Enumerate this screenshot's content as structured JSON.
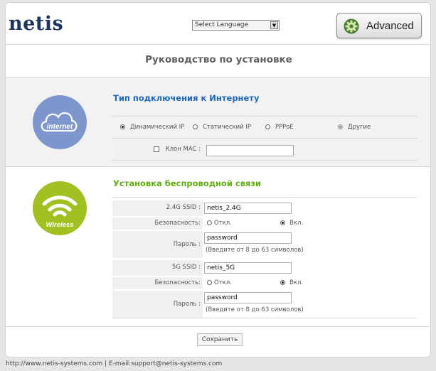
{
  "header": {
    "logo": "netis",
    "language_select": "Select Language",
    "advanced_label": "Advanced"
  },
  "page_title": "Руководство по установке",
  "internet": {
    "title": "Тип подключения к Интернету",
    "icon_text": "internet",
    "connection_types": [
      {
        "label": "Динамический IP",
        "selected": true
      },
      {
        "label": "Статический IP",
        "selected": false
      },
      {
        "label": "PPPoE",
        "selected": false
      },
      {
        "label": "Другие",
        "selected": false
      }
    ],
    "clone_mac_label": "Клон MAC :",
    "clone_mac_value": ""
  },
  "wireless": {
    "title": "Установка беспроводной связи",
    "icon_text": "Wireless",
    "band_24": {
      "ssid_label": "2.4G SSID :",
      "ssid_value": "netis_2.4G",
      "security_label": "Безопасность:",
      "off_label": "Откл.",
      "on_label": "Вкл.",
      "security_on": true,
      "password_label": "Пароль :",
      "password_value": "password",
      "password_hint": "(Введите от 8 до 63 символов)"
    },
    "band_5": {
      "ssid_label": "5G SSID :",
      "ssid_value": "netis_5G",
      "security_label": "Безопасность:",
      "off_label": "Откл.",
      "on_label": "Вкл.",
      "security_on": true,
      "password_label": "Пароль :",
      "password_value": "password",
      "password_hint": "(Введите от 8 до 63 символов)"
    }
  },
  "save_label": "Сохранить",
  "footer": "http://www.netis-systems.com | E-mail:support@netis-systems.com",
  "colors": {
    "logo": "#1d3560",
    "internet_title": "#1e67b6",
    "wireless_title": "#5fae12",
    "internet_circle": "#7d96cd",
    "wireless_circle": "#a1c123"
  }
}
